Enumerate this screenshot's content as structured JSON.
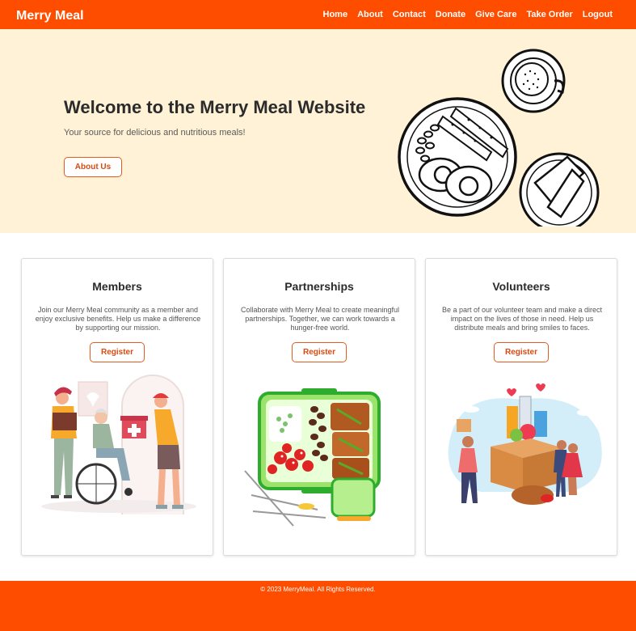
{
  "brand": "Merry Meal",
  "nav": [
    "Home",
    "About",
    "Contact",
    "Donate",
    "Give Care",
    "Take Order",
    "Logout"
  ],
  "hero": {
    "title": "Welcome to the Merry Meal Website",
    "subtitle": "Your source for delicious and nutritious meals!",
    "button": "About Us"
  },
  "cards": [
    {
      "title": "Members",
      "text": "Join our Merry Meal community as a member and enjoy exclusive benefits. Help us make a difference by supporting our mission.",
      "button": "Register"
    },
    {
      "title": "Partnerships",
      "text": "Collaborate with Merry Meal to create meaningful partnerships. Together, we can work towards a hunger-free world.",
      "button": "Register"
    },
    {
      "title": "Volunteers",
      "text": "Be a part of our volunteer team and make a direct impact on the lives of those in need. Help us distribute meals and bring smiles to faces.",
      "button": "Register"
    }
  ],
  "footer": "© 2023 MerryMeal. All Rights Reserved.",
  "colors": {
    "accent": "#ff4d00",
    "hero_bg": "#fff2d6",
    "button_text": "#d84a12"
  },
  "icons": {
    "hero": "breakfast-plate-illustration",
    "members": "caregiver-wheelchair-illustration",
    "partnerships": "lunchbox-meal-illustration",
    "volunteers": "donation-box-illustration"
  }
}
